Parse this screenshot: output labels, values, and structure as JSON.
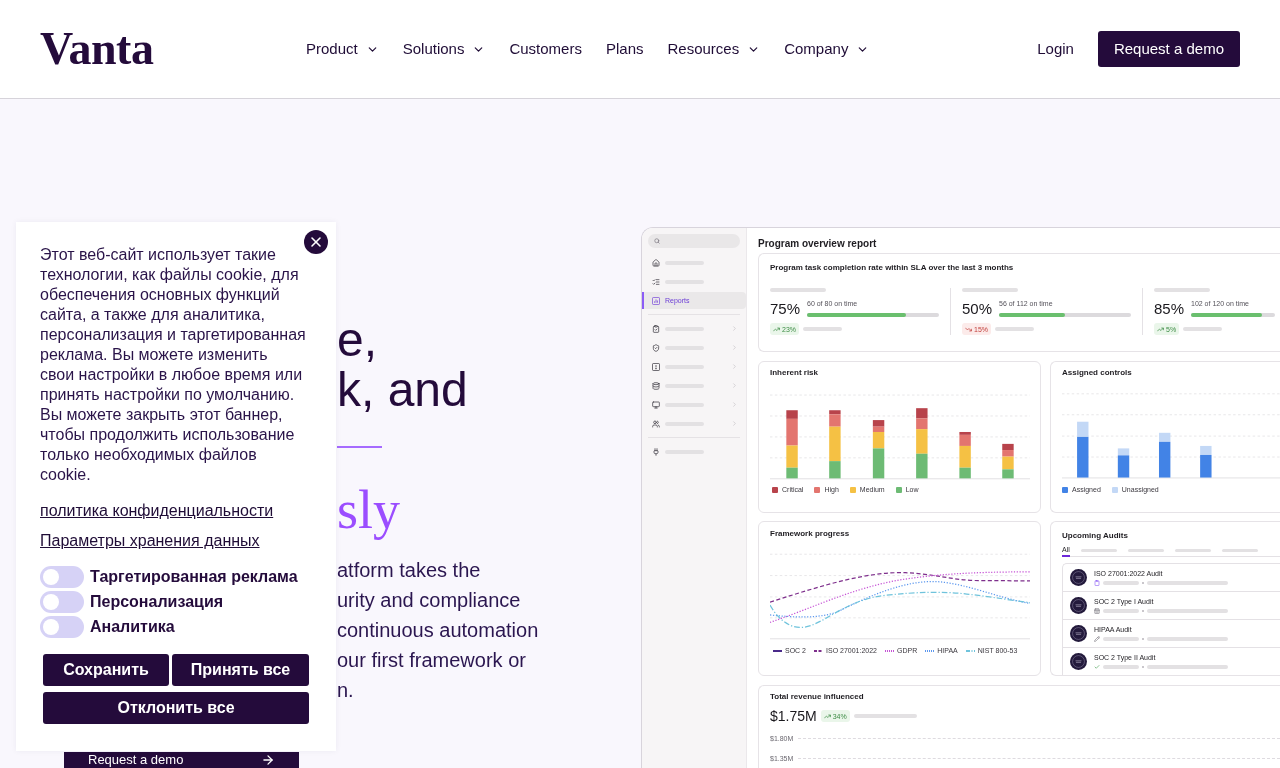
{
  "header": {
    "logo": "Vanta",
    "nav": [
      {
        "label": "Product",
        "has_menu": true
      },
      {
        "label": "Solutions",
        "has_menu": true
      },
      {
        "label": "Customers",
        "has_menu": false
      },
      {
        "label": "Plans",
        "has_menu": false
      },
      {
        "label": "Resources",
        "has_menu": true
      },
      {
        "label": "Company",
        "has_menu": true
      }
    ],
    "login": "Login",
    "cta": "Request a demo"
  },
  "hero": {
    "headline_lines": [
      "e,",
      "k, and"
    ],
    "accent": "sly",
    "body_lines": [
      "atform takes the",
      "urity and compliance",
      "continuous automation",
      "our first framework or",
      "n."
    ],
    "cta": "Request a demo"
  },
  "cookie_banner": {
    "text_lines": [
      "Этот веб-сайт использует такие",
      "технологии, как файлы cookie, для",
      "обеспечения основных функций",
      "сайта, а также для аналитика,",
      "персонализация и таргетированная",
      "реклама. Вы можете изменить",
      "свои настройки в любое время или",
      "принять настройки по умолчанию.",
      "Вы можете закрыть этот баннер,",
      "чтобы продолжить использование",
      "только необходимых файлов",
      "cookie."
    ],
    "links": [
      "политика конфиденциальности",
      "Параметры хранения данных"
    ],
    "toggles": [
      {
        "label": "Таргетированная реклама",
        "on": false
      },
      {
        "label": "Персонализация",
        "on": false
      },
      {
        "label": "Аналитика",
        "on": false
      }
    ],
    "buttons": [
      "Сохранить",
      "Принять все",
      "Отклонить все"
    ]
  },
  "dashboard": {
    "sidebar": {
      "groups": [
        [
          {
            "selected": false,
            "expandable": false
          },
          {
            "selected": false,
            "expandable": false
          },
          {
            "label": "Reports",
            "selected": true,
            "expandable": false
          }
        ],
        [
          {
            "selected": false,
            "expandable": true
          },
          {
            "selected": false,
            "expandable": true
          },
          {
            "selected": false,
            "expandable": true
          },
          {
            "selected": false,
            "expandable": true
          },
          {
            "selected": false,
            "expandable": true
          },
          {
            "selected": false,
            "expandable": true
          }
        ],
        [
          {
            "selected": false,
            "expandable": false
          }
        ]
      ]
    },
    "title": "Program overview report",
    "sla_card": {
      "title": "Program task completion rate within SLA over the last 3 months",
      "stats": [
        {
          "value": "75%",
          "detail": "60 of 80 on time",
          "level": 0.75,
          "change": "23%",
          "kind": "up"
        },
        {
          "value": "50%",
          "detail": "56 of 112 on time",
          "level": 0.5,
          "change": "15%",
          "kind": "down"
        },
        {
          "value": "85%",
          "detail": "102 of 120 on time",
          "level": 0.85,
          "change": "5%",
          "kind": "up"
        }
      ]
    },
    "inherent_risk": {
      "title": "Inherent risk",
      "legend": [
        {
          "label": "Critical",
          "color": "#b8434b"
        },
        {
          "label": "High",
          "color": "#e3756f"
        },
        {
          "label": "Medium",
          "color": "#f5c144"
        },
        {
          "label": "Low",
          "color": "#6dbb74"
        }
      ]
    },
    "assigned_controls": {
      "title": "Assigned controls",
      "legend": [
        {
          "label": "Assigned",
          "color": "#4283e6"
        },
        {
          "label": "Unassigned",
          "color": "#c3d8f6"
        }
      ]
    },
    "framework_progress": {
      "title": "Framework progress",
      "legend": [
        {
          "label": "SOC 2",
          "color": "#4a2a8a",
          "kind": "solid"
        },
        {
          "label": "ISO 27001:2022",
          "color": "#7e2f8c",
          "kind": "dashed"
        },
        {
          "label": "GDPR",
          "color": "#c653d6",
          "kind": "dotted"
        },
        {
          "label": "HIPAA",
          "color": "#5d98ee",
          "kind": "dotted"
        },
        {
          "label": "NIST 800-53",
          "color": "#6fc3dc",
          "kind": "dashdot"
        }
      ]
    },
    "upcoming_audits": {
      "title": "Upcoming Audits",
      "tabs": [
        {
          "label": "All",
          "selected": true
        },
        {
          "selected": false
        },
        {
          "selected": false
        },
        {
          "selected": false
        },
        {
          "selected": false
        }
      ],
      "audits": [
        {
          "name": "ISO 27001:2022 Audit"
        },
        {
          "name": "SOC 2 Type I Audit"
        },
        {
          "name": "HIPAA Audit"
        },
        {
          "name": "SOC 2 Type II Audit"
        }
      ]
    },
    "revenue": {
      "title": "Total revenue influenced",
      "value": "$1.75M",
      "change": "34%",
      "kind": "up",
      "axis_labels": [
        "$1.80M",
        "$1.35M"
      ]
    }
  }
}
